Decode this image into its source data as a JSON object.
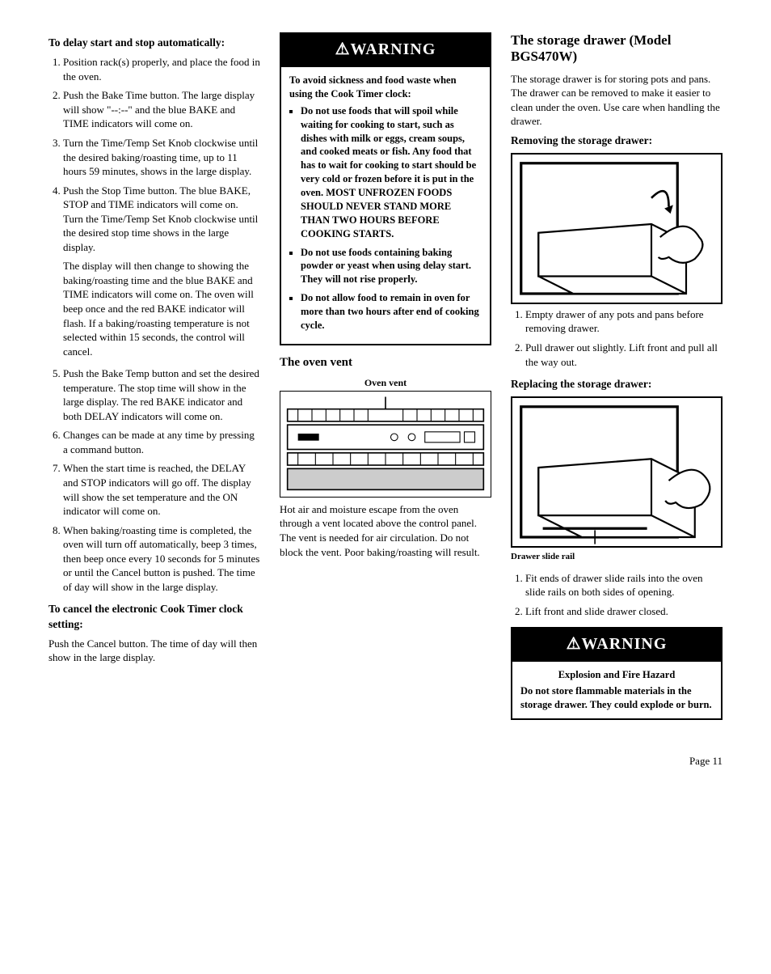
{
  "col1": {
    "heading_delay": "To delay start and stop automatically:",
    "steps": [
      "Position rack(s) properly, and place the food in the oven.",
      "Push the Bake Time button. The large display will show \"--:--\" and the blue BAKE and TIME indicators will come on.",
      "Turn the Time/Temp Set Knob clockwise until the desired baking/roasting time, up to 11 hours 59 minutes, shows in the large display.",
      "Push the Stop Time button. The blue BAKE, STOP and TIME indicators will come on. Turn the Time/Temp Set Knob clockwise until the desired stop time shows in the large display."
    ],
    "step4_extra": "The display will then change to showing the baking/roasting time and the blue BAKE and TIME indicators will come on. The oven will beep once and the red BAKE indicator will flash. If a baking/roasting temperature is not selected within 15 seconds, the control will cancel.",
    "steps2": [
      "Push the Bake Temp button and set the desired temperature. The stop time will show in the large display. The red BAKE indicator and both DELAY indicators will come on.",
      "Changes can be made at any time by pressing a command button.",
      "When the start time is reached, the DELAY and STOP indicators will go off. The display will show the set temperature and the ON indicator will come on.",
      "When baking/roasting time is completed, the oven will turn off automatically, beep 3 times, then beep once every 10 seconds for 5 minutes or until the Cancel button is pushed. The time of day will show in the large display."
    ],
    "heading_cancel": "To cancel the electronic Cook Timer clock setting:",
    "cancel_para": "Push the Cancel button. The time of day will then show in the large display."
  },
  "col2": {
    "warning_title": "⚠WARNING",
    "warning_intro": "To avoid sickness and food waste when using the Cook Timer clock:",
    "warning_items": [
      "Do not use foods that will spoil while waiting for cooking to start, such as dishes with milk or eggs, cream soups, and cooked meats or fish. Any food that has to wait for cooking to start should be very cold or frozen before it is put in the oven. MOST UNFROZEN FOODS SHOULD NEVER STAND MORE THAN TWO HOURS BEFORE COOKING STARTS.",
      "Do not use foods containing baking powder or yeast when using delay start. They will not rise properly.",
      "Do not allow food to remain in oven for more than two hours after end of cooking cycle."
    ],
    "vent_heading": "The oven vent",
    "vent_label": "Oven vent",
    "vent_para": "Hot air and moisture escape from the oven through a vent located above the control panel. The vent is needed for air circulation. Do not block the vent. Poor baking/roasting will result."
  },
  "col3": {
    "storage_heading": "The storage drawer (Model BGS470W)",
    "storage_intro": "The storage drawer is for storing pots and pans. The drawer can be removed to make it easier to clean under the oven. Use care when handling the drawer.",
    "remove_heading": "Removing the storage drawer:",
    "remove_steps": [
      "Empty drawer of any pots and pans before removing drawer.",
      "Pull drawer out slightly. Lift front and pull all the way out."
    ],
    "replace_heading": "Replacing the storage drawer:",
    "slide_rail_caption": "Drawer slide rail",
    "replace_steps": [
      "Fit ends of drawer slide rails into the oven slide rails on both sides of opening.",
      "Lift front and slide drawer closed."
    ],
    "warning2_title": "⚠WARNING",
    "warning2_sub": "Explosion and Fire Hazard",
    "warning2_body": "Do not store flammable materials in the storage drawer. They could explode or burn."
  },
  "page_number": "Page 11"
}
